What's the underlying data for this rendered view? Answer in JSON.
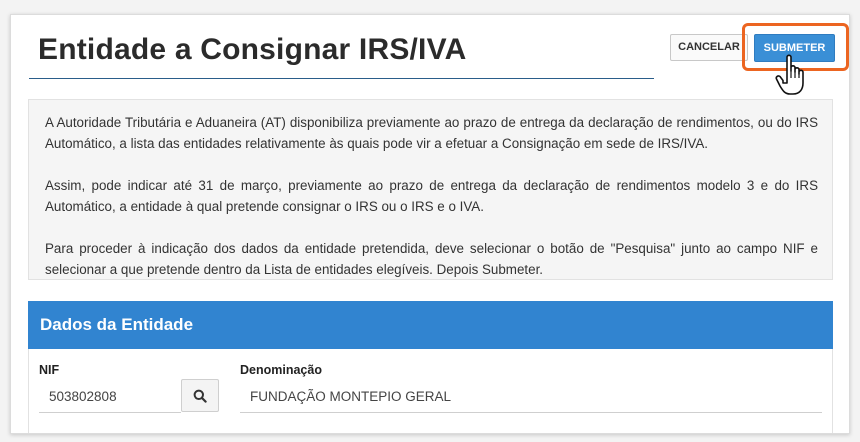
{
  "page": {
    "title": "Entidade a Consignar IRS/IVA"
  },
  "toolbar": {
    "cancel_label": "CANCELAR",
    "submit_label": "SUBMETER",
    "highlight_color": "#ec6521"
  },
  "info": {
    "paragraphs": [
      "A Autoridade Tributária e Aduaneira (AT) disponibiliza previamente ao prazo de entrega da declaração de rendimentos, ou do IRS Automático, a lista das entidades relativamente às quais pode vir a efetuar a Consignação em sede de IRS/IVA.",
      "Assim, pode indicar até 31 de março, previamente ao prazo de entrega da declaração de rendimentos modelo 3 e do IRS Automático, a entidade à qual pretende consignar o IRS ou o IRS e o IVA.",
      "Para proceder à indicação dos dados da entidade pretendida, deve selecionar o botão de \"Pesquisa\" junto ao campo NIF e selecionar a que pretende dentro da Lista de entidades elegíveis. Depois Submeter."
    ]
  },
  "panel": {
    "title": "Dados da Entidade",
    "header_color": "#3184d0",
    "nif": {
      "label": "NIF",
      "value": "503802808",
      "search_icon": "search-icon"
    },
    "denominacao": {
      "label": "Denominação",
      "value": "FUNDAÇÃO MONTEPIO GERAL"
    }
  },
  "cursor": {
    "icon": "hand-pointer-icon"
  }
}
